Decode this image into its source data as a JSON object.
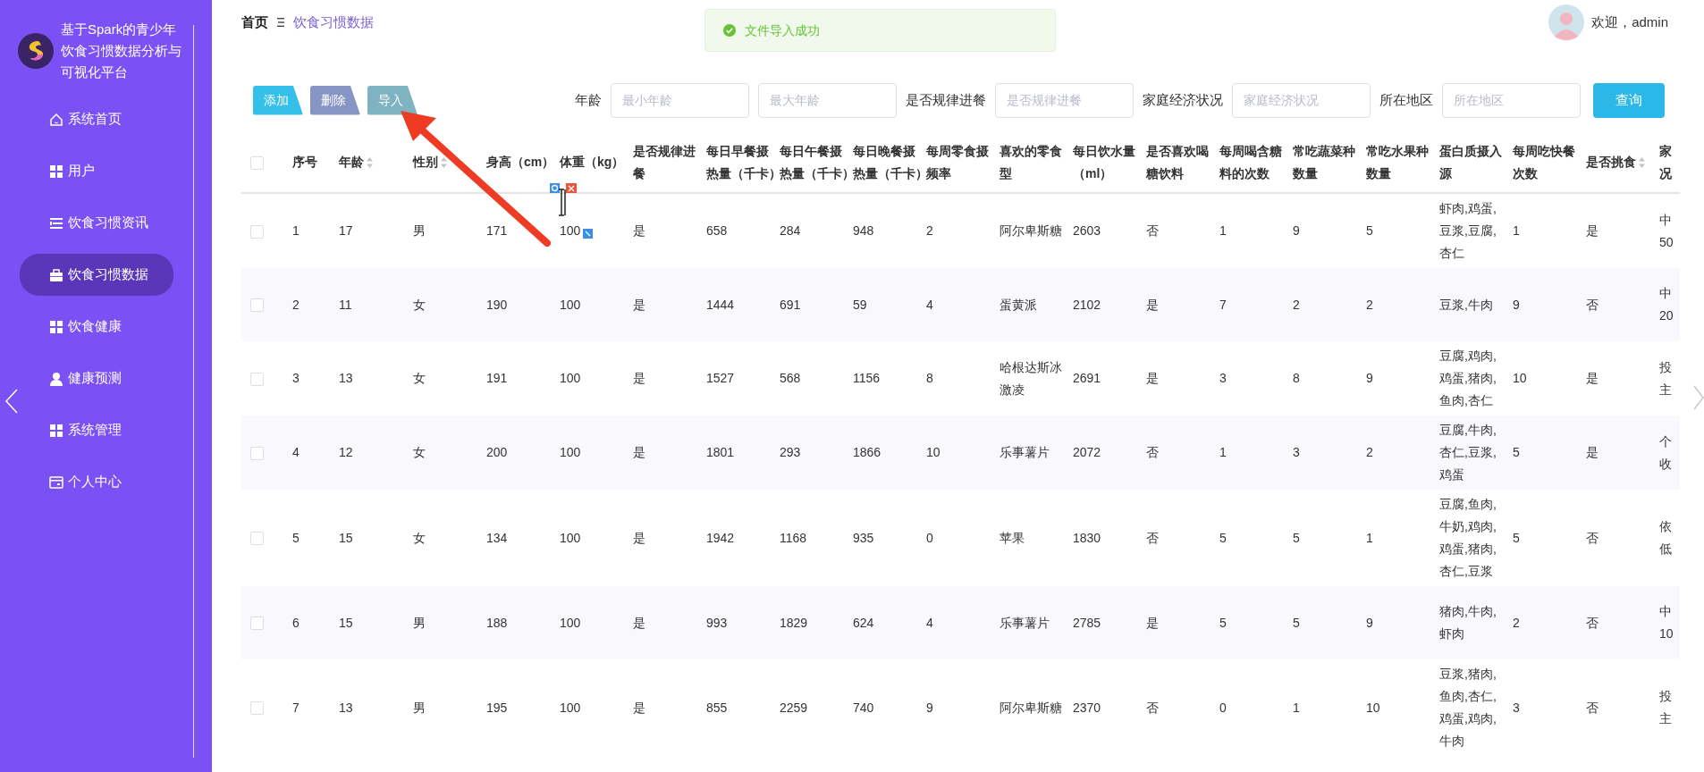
{
  "sidebar": {
    "title_lines": [
      "基于Spark的青少年",
      "饮食习惯数据分析与",
      "可视化平台"
    ],
    "items": [
      {
        "label": "系统首页",
        "selected": false
      },
      {
        "label": "用户",
        "selected": false
      },
      {
        "label": "饮食习惯资讯",
        "selected": false
      },
      {
        "label": "饮食习惯数据",
        "selected": true
      },
      {
        "label": "饮食健康",
        "selected": false
      },
      {
        "label": "健康预测",
        "selected": false
      },
      {
        "label": "系统管理",
        "selected": false
      },
      {
        "label": "个人中心",
        "selected": false
      }
    ]
  },
  "breadcrumb": [
    "首页",
    "饮食习惯数据"
  ],
  "toast": {
    "message": "文件导入成功"
  },
  "user": {
    "greeting": "欢迎，admin"
  },
  "toolbar_buttons": [
    {
      "label": "添加",
      "color": "#34c0e8"
    },
    {
      "label": "删除",
      "color": "#8795c4"
    },
    {
      "label": "导入",
      "color": "#80b3c1"
    }
  ],
  "filters": [
    {
      "label": "年龄",
      "fields": [
        {
          "placeholder": "最小年龄"
        },
        {
          "placeholder": "最大年龄"
        }
      ]
    },
    {
      "label": "是否规律进餐",
      "fields": [
        {
          "placeholder": "是否规律进餐"
        }
      ]
    },
    {
      "label": "家庭经济状况",
      "fields": [
        {
          "placeholder": "家庭经济状况"
        }
      ]
    },
    {
      "label": "所在地区",
      "fields": [
        {
          "placeholder": "所在地区"
        }
      ]
    }
  ],
  "search_button": "查询",
  "table": {
    "all_checked": false,
    "columns": [
      {
        "lines": [
          "序号"
        ],
        "sortable": false
      },
      {
        "lines": [
          "年龄"
        ],
        "sortable": true
      },
      {
        "lines": [
          "性别"
        ],
        "sortable": true
      },
      {
        "lines": [
          "身高（cm）"
        ],
        "sortable": false
      },
      {
        "lines": [
          "体重（kg）"
        ],
        "sortable": false
      },
      {
        "lines": [
          "是否规律进",
          "餐"
        ],
        "sortable": false
      },
      {
        "lines": [
          "每日早餐摄",
          "热量（千卡）"
        ],
        "sortable": false
      },
      {
        "lines": [
          "每日午餐摄",
          "热量（千卡）"
        ],
        "sortable": false
      },
      {
        "lines": [
          "每日晚餐摄",
          "热量（千卡）"
        ],
        "sortable": false
      },
      {
        "lines": [
          "每周零食摄",
          "频率"
        ],
        "sortable": false
      },
      {
        "lines": [
          "喜欢的零食",
          "型"
        ],
        "sortable": false
      },
      {
        "lines": [
          "每日饮水量",
          "（ml）"
        ],
        "sortable": false
      },
      {
        "lines": [
          "是否喜欢喝",
          "糖饮料"
        ],
        "sortable": false
      },
      {
        "lines": [
          "每周喝含糖",
          "料的次数"
        ],
        "sortable": false
      },
      {
        "lines": [
          "常吃蔬菜种",
          "数量"
        ],
        "sortable": false
      },
      {
        "lines": [
          "常吃水果种",
          "数量"
        ],
        "sortable": false
      },
      {
        "lines": [
          "蛋白质摄入",
          "源"
        ],
        "sortable": false
      },
      {
        "lines": [
          "每周吃快餐",
          "次数"
        ],
        "sortable": false
      },
      {
        "lines": [
          "是否挑食"
        ],
        "sortable": true
      },
      {
        "lines": [
          "家",
          "况"
        ],
        "sortable": false
      }
    ],
    "rows": [
      {
        "checked": false,
        "cells": [
          "1",
          "17",
          "男",
          "171",
          "100",
          "是",
          "658",
          "284",
          "948",
          "2",
          "阿尔卑斯糖",
          "2603",
          "否",
          "1",
          "9",
          "5",
          "虾肉,鸡蛋,豆浆,豆腐,杏仁",
          "1",
          "是",
          [
            "中",
            "50"
          ]
        ]
      },
      {
        "checked": false,
        "cells": [
          "2",
          "11",
          "女",
          "190",
          "100",
          "是",
          "1444",
          "691",
          "59",
          "4",
          "蛋黄派",
          "2102",
          "是",
          "7",
          "2",
          "2",
          "豆浆,牛肉",
          "9",
          "否",
          [
            "中",
            "20"
          ]
        ]
      },
      {
        "checked": false,
        "cells": [
          "3",
          "13",
          "女",
          "191",
          "100",
          "是",
          "1527",
          "568",
          "1156",
          "8",
          "哈根达斯冰激凌",
          "2691",
          "是",
          "3",
          "8",
          "9",
          "豆腐,鸡肉,鸡蛋,猪肉,鱼肉,杏仁",
          "10",
          "是",
          [
            "投",
            "主"
          ]
        ]
      },
      {
        "checked": false,
        "cells": [
          "4",
          "12",
          "女",
          "200",
          "100",
          "是",
          "1801",
          "293",
          "1866",
          "10",
          "乐事薯片",
          "2072",
          "否",
          "1",
          "3",
          "2",
          "豆腐,牛肉,杏仁,豆浆,鸡蛋",
          "5",
          "是",
          [
            "个",
            "收"
          ]
        ]
      },
      {
        "checked": false,
        "cells": [
          "5",
          "15",
          "女",
          "134",
          "100",
          "是",
          "1942",
          "1168",
          "935",
          "0",
          "苹果",
          "1830",
          "否",
          "5",
          "5",
          "1",
          "豆腐,鱼肉,牛奶,鸡肉,鸡蛋,猪肉,杏仁,豆浆",
          "5",
          "否",
          [
            "依",
            "低"
          ]
        ]
      },
      {
        "checked": false,
        "cells": [
          "6",
          "15",
          "男",
          "188",
          "100",
          "是",
          "993",
          "1829",
          "624",
          "4",
          "乐事薯片",
          "2785",
          "是",
          "5",
          "5",
          "9",
          "猪肉,牛肉,虾肉",
          "2",
          "否",
          [
            "中",
            "10"
          ]
        ]
      },
      {
        "checked": false,
        "cells": [
          "7",
          "13",
          "男",
          "195",
          "100",
          "是",
          "855",
          "2259",
          "740",
          "9",
          "阿尔卑斯糖",
          "2370",
          "否",
          "0",
          "1",
          "10",
          "豆浆,猪肉,鱼肉,杏仁,鸡蛋,鸡肉,牛肉",
          "3",
          "否",
          [
            "投",
            "主"
          ]
        ]
      }
    ]
  }
}
